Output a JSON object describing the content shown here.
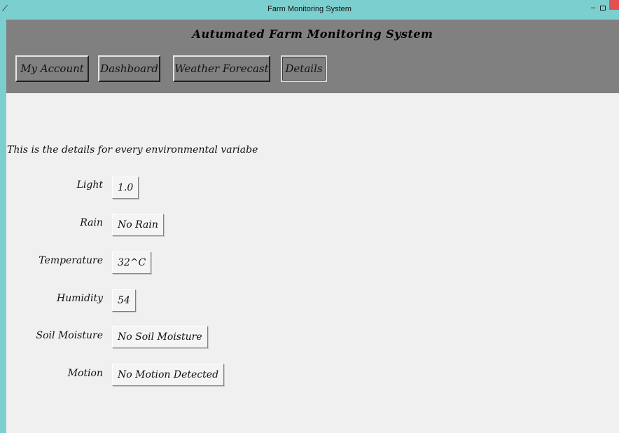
{
  "window": {
    "title": "Farm Monitoring System",
    "app_icon": "feather-icon",
    "minimize_glyph": "–",
    "controls": [
      "minimize-icon",
      "maximize-icon",
      "close-icon"
    ]
  },
  "header": {
    "app_title": "Autumated Farm Monitoring System",
    "background": "#808080",
    "nav": [
      {
        "label": "My Account",
        "active": false
      },
      {
        "label": "Dashboard",
        "active": false
      },
      {
        "label": "Weather Forecast",
        "active": false
      },
      {
        "label": "Details",
        "active": true
      }
    ]
  },
  "main": {
    "description": "This is the details for every environmental variabe",
    "rows": [
      {
        "label": "Light",
        "value": "1.0"
      },
      {
        "label": "Rain",
        "value": "No Rain"
      },
      {
        "label": "Temperature",
        "value": "32^C"
      },
      {
        "label": "Humidity",
        "value": "54"
      },
      {
        "label": "Soil Moisture",
        "value": "No Soil Moisture"
      },
      {
        "label": "Motion",
        "value": "No Motion Detected"
      }
    ]
  },
  "colors": {
    "titlebar": "#7ccfcf",
    "header": "#808080",
    "content": "#f0f0f0",
    "close": "#e35050"
  }
}
